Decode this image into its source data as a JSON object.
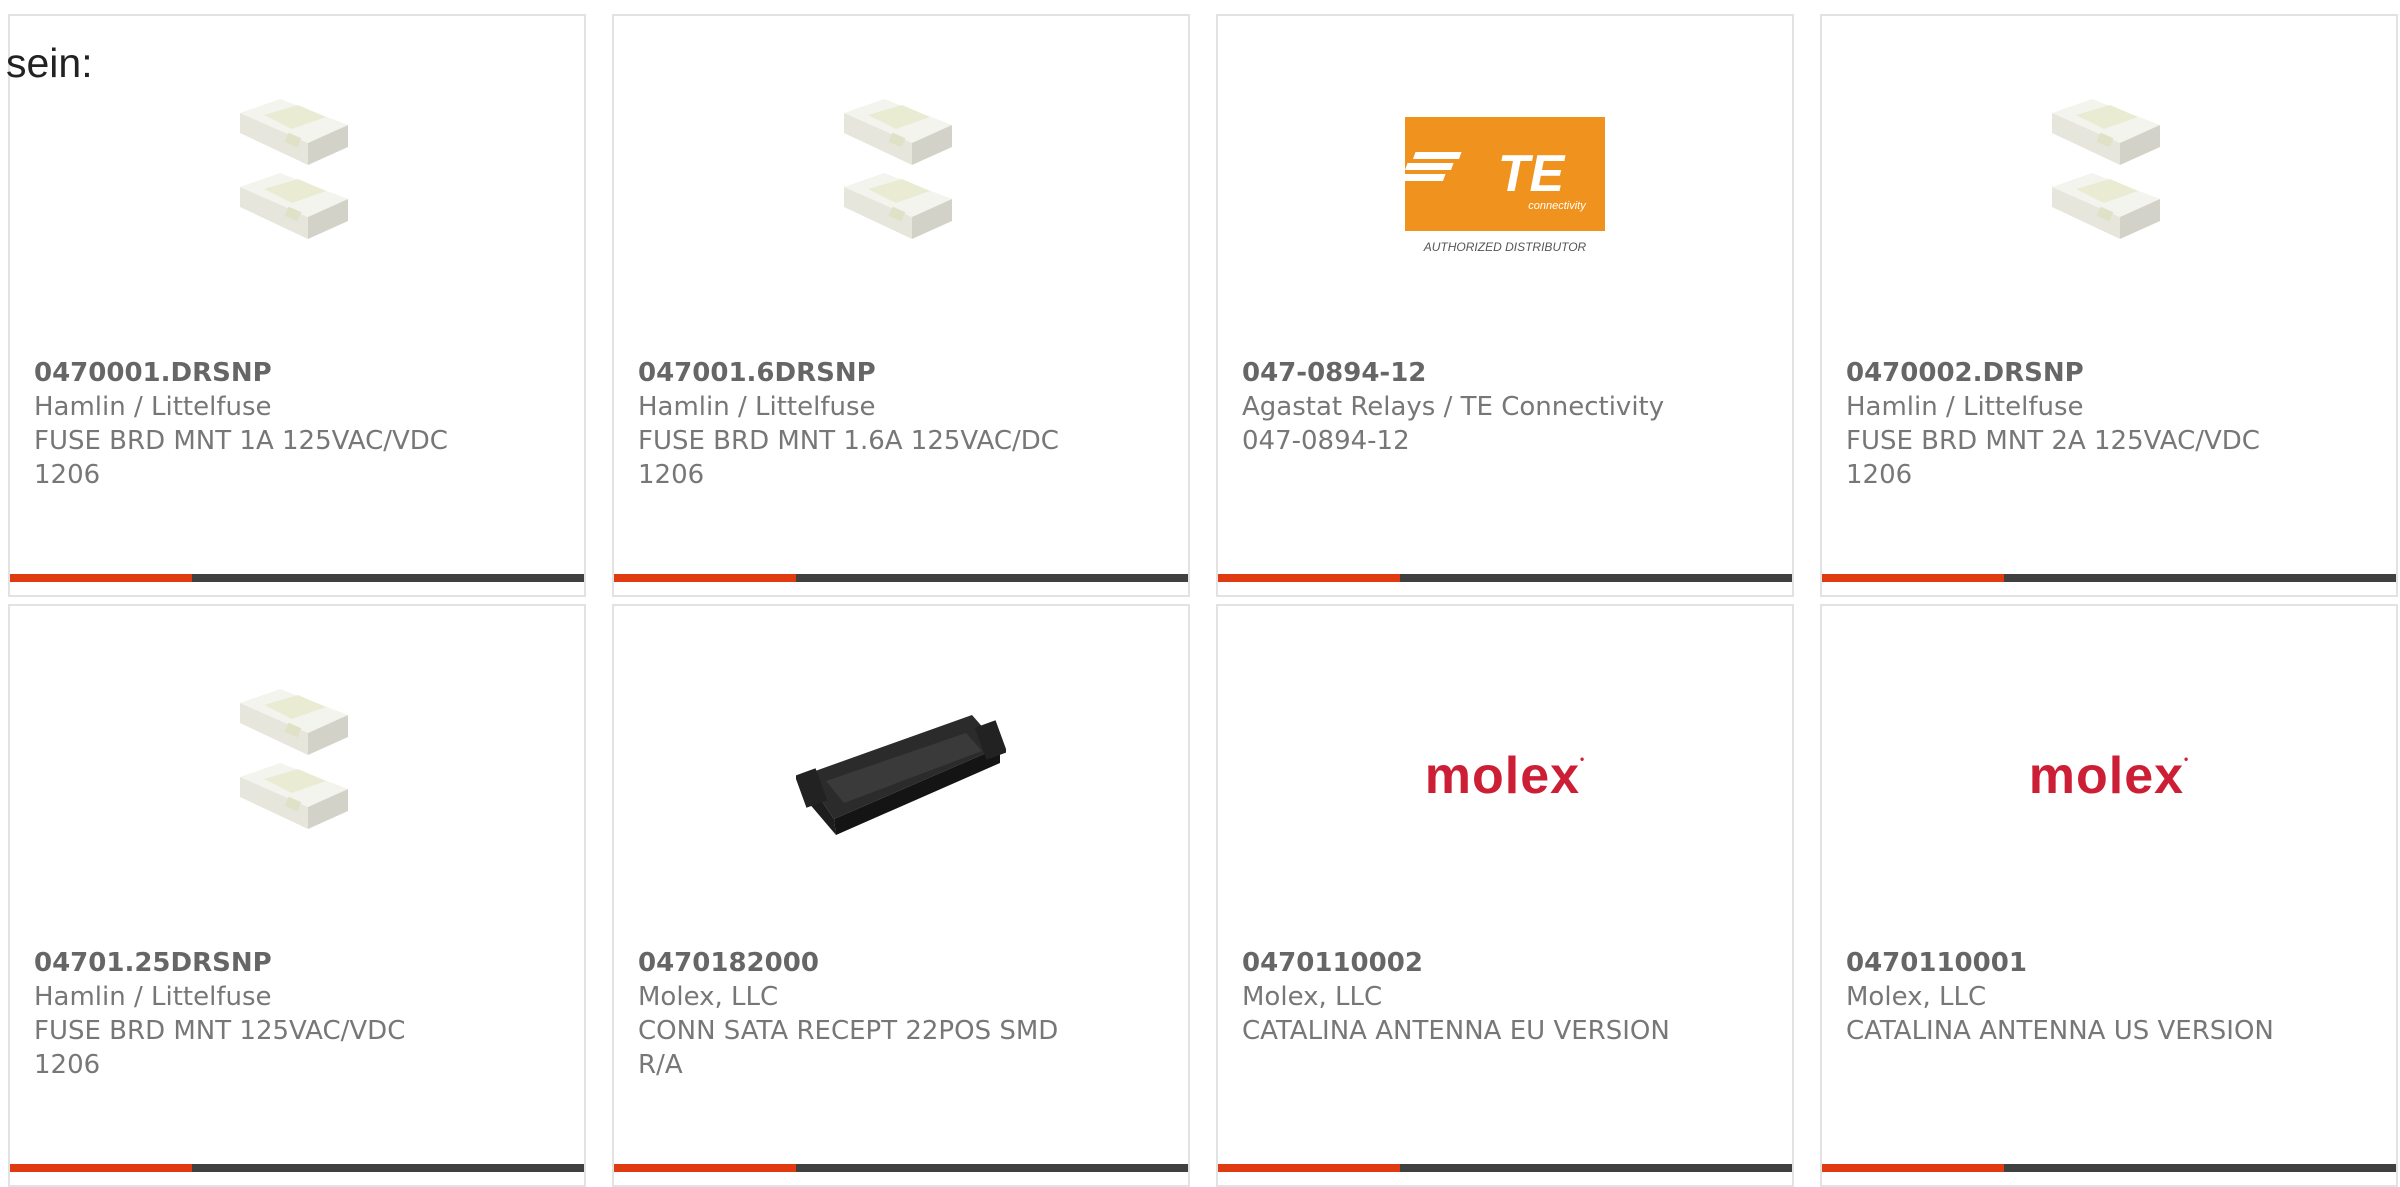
{
  "intro_text": "sein:",
  "colors": {
    "accent": "#e03a10",
    "bar": "#404040",
    "te_orange": "#f0931e",
    "molex_red": "#cc1f36"
  },
  "products": [
    {
      "part_number": "0470001.DRSNP",
      "manufacturer": "Hamlin / Littelfuse",
      "desc1": "FUSE BRD MNT 1A 125VAC/VDC",
      "desc2": "1206",
      "image": "fuse-pair-image"
    },
    {
      "part_number": "047001.6DRSNP",
      "manufacturer": "Hamlin / Littelfuse",
      "desc1": "FUSE BRD MNT 1.6A 125VAC/DC",
      "desc2": "1206",
      "image": "fuse-pair-image"
    },
    {
      "part_number": "047-0894-12",
      "manufacturer": "Agastat Relays / TE Connectivity",
      "desc1": "047-0894-12",
      "desc2": "",
      "image": "te-connectivity-logo",
      "logo_main": "TE",
      "logo_sub": "connectivity",
      "logo_caption": "AUTHORIZED DISTRIBUTOR"
    },
    {
      "part_number": "0470002.DRSNP",
      "manufacturer": "Hamlin / Littelfuse",
      "desc1": "FUSE BRD MNT 2A 125VAC/VDC",
      "desc2": "1206",
      "image": "fuse-pair-image"
    },
    {
      "part_number": "04701.25DRSNP",
      "manufacturer": "Hamlin / Littelfuse",
      "desc1": "FUSE BRD MNT 125VAC/VDC",
      "desc2": "1206",
      "image": "fuse-pair-image"
    },
    {
      "part_number": "0470182000",
      "manufacturer": "Molex, LLC",
      "desc1": "CONN SATA RECEPT 22POS SMD",
      "desc2": "R/A",
      "image": "connector-image"
    },
    {
      "part_number": "0470110002",
      "manufacturer": "Molex, LLC",
      "desc1": "CATALINA ANTENNA EU VERSION",
      "desc2": "",
      "image": "molex-logo",
      "logo_text": "molex"
    },
    {
      "part_number": "0470110001",
      "manufacturer": "Molex, LLC",
      "desc1": "CATALINA ANTENNA US VERSION",
      "desc2": "",
      "image": "molex-logo",
      "logo_text": "molex"
    }
  ]
}
